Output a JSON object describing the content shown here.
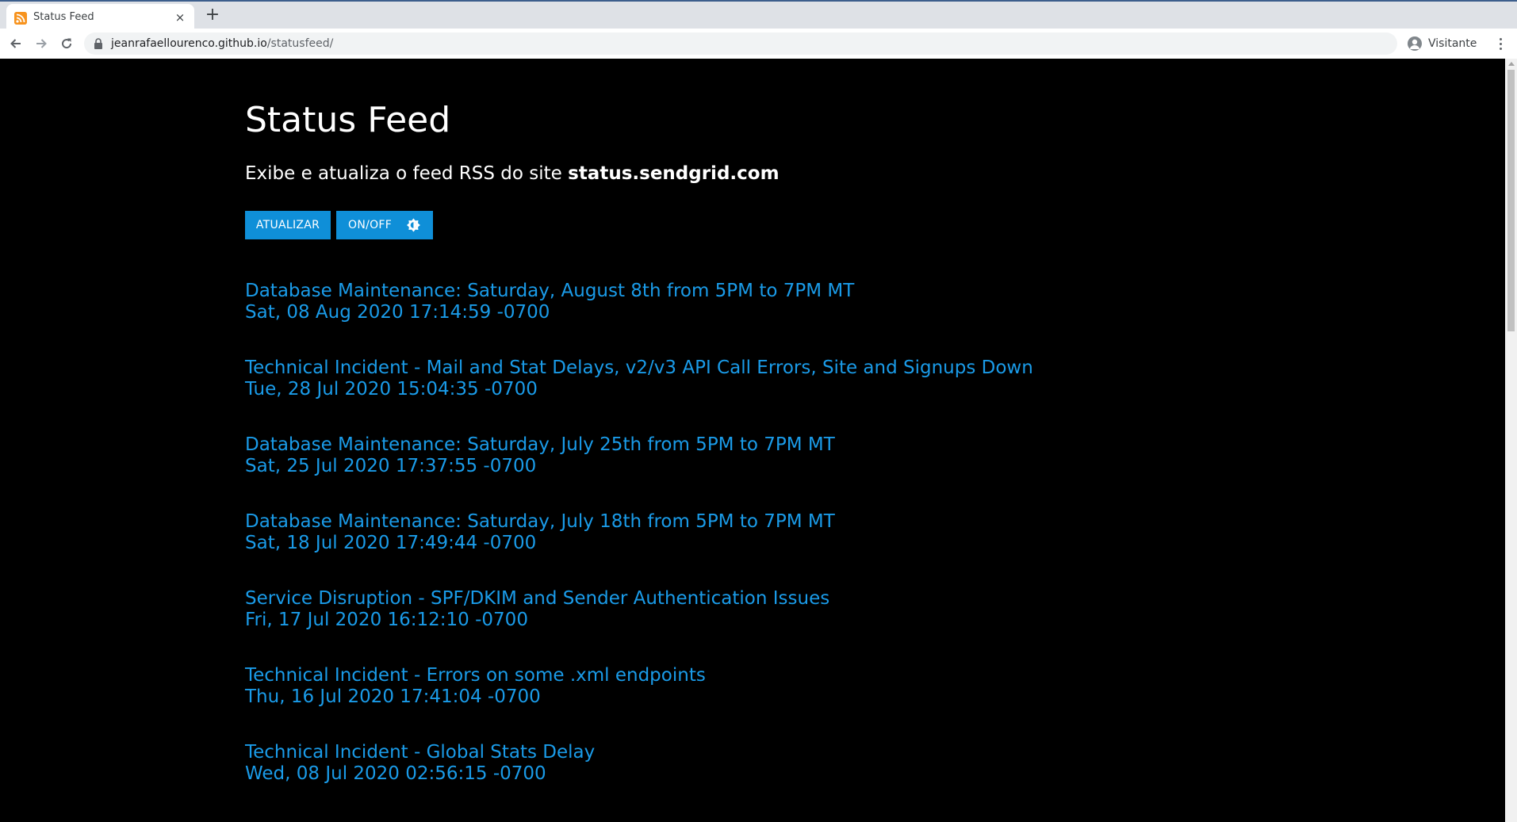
{
  "browser": {
    "tab_title": "Status Feed",
    "tab_close": "×",
    "new_tab": "+",
    "url_host": "jeanrafaellourenco.github.io",
    "url_path": "/statusfeed/",
    "profile_name": "Visitante"
  },
  "page": {
    "title": "Status Feed",
    "subtitle_text": "Exibe e atualiza o feed RSS do site ",
    "subtitle_site": "status.sendgrid.com",
    "refresh_label": "ATUALIZAR",
    "toggle_label": "ON/OFF",
    "toggle_icon": "brightness-icon"
  },
  "colors": {
    "background": "#000000",
    "accent_button": "#0f8fd8",
    "link": "#1a9be8"
  },
  "feed": [
    {
      "title": "Database Maintenance: Saturday, August 8th from 5PM to 7PM MT",
      "date": "Sat, 08 Aug 2020 17:14:59 -0700"
    },
    {
      "title": "Technical Incident - Mail and Stat Delays, v2/v3 API Call Errors, Site and Signups Down",
      "date": "Tue, 28 Jul 2020 15:04:35 -0700"
    },
    {
      "title": "Database Maintenance: Saturday, July 25th from 5PM to 7PM MT",
      "date": "Sat, 25 Jul 2020 17:37:55 -0700"
    },
    {
      "title": "Database Maintenance: Saturday, July 18th from 5PM to 7PM MT",
      "date": "Sat, 18 Jul 2020 17:49:44 -0700"
    },
    {
      "title": "Service Disruption - SPF/DKIM and Sender Authentication Issues",
      "date": "Fri, 17 Jul 2020 16:12:10 -0700"
    },
    {
      "title": "Technical Incident - Errors on some .xml endpoints",
      "date": "Thu, 16 Jul 2020 17:41:04 -0700"
    },
    {
      "title": "Technical Incident - Global Stats Delay",
      "date": "Wed, 08 Jul 2020 02:56:15 -0700"
    }
  ]
}
